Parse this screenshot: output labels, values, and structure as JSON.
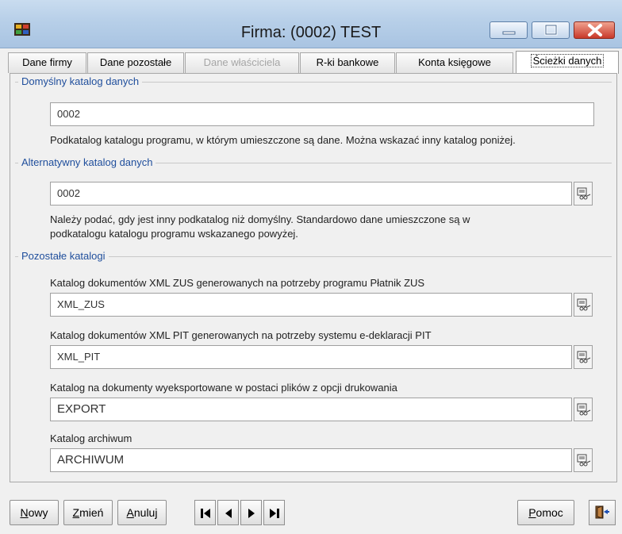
{
  "window": {
    "title": "Firma: (0002) TEST",
    "icons": {
      "app": "film-app-icon",
      "minimize": "minimize-icon",
      "maximize": "maximize-icon",
      "close": "close-icon"
    }
  },
  "tabs": [
    {
      "label": "Dane firmy",
      "state": "normal"
    },
    {
      "label": "Dane pozostałe",
      "state": "normal"
    },
    {
      "label": "Dane właściciela",
      "state": "disabled"
    },
    {
      "label": "R-ki bankowe",
      "state": "normal"
    },
    {
      "label": "Konta księgowe",
      "state": "normal"
    },
    {
      "label": "Ścieżki danych",
      "state": "active"
    }
  ],
  "default_dir": {
    "group_label": "Domyślny katalog danych",
    "value": "0002",
    "hint": "Podkatalog katalogu programu, w którym umieszczone są dane. Można wskazać inny katalog poniżej."
  },
  "alt_dir": {
    "group_label": "Alternatywny katalog danych",
    "value": "0002",
    "hint_line1": "Należy podać, gdy jest inny podkatalog niż domyślny. Standardowo dane umieszczone są w",
    "hint_line2": "podkatalogu katalogu programu wskazanego powyżej."
  },
  "other_dirs": {
    "group_label": "Pozostałe katalogi",
    "items": [
      {
        "label": "Katalog dokumentów XML ZUS generowanych na potrzeby programu Płatnik ZUS",
        "value": "XML_ZUS"
      },
      {
        "label": "Katalog dokumentów XML PIT generowanych na potrzeby systemu e-deklaracji PIT",
        "value": "XML_PIT"
      },
      {
        "label": "Katalog na dokumenty wyeksportowane w postaci plików z opcji drukowania",
        "value": "EXPORT"
      },
      {
        "label": "Katalog archiwum",
        "value": "ARCHIWUM"
      }
    ]
  },
  "buttons": {
    "new": {
      "hotkey": "N",
      "rest": "owy"
    },
    "edit": {
      "hotkey": "Z",
      "rest": "mień"
    },
    "cancel": {
      "hotkey": "A",
      "rest": "nuluj"
    },
    "help": {
      "hotkey": "P",
      "rest": "omoc"
    }
  },
  "nav_icons": [
    "first-record-icon",
    "previous-record-icon",
    "next-record-icon",
    "last-record-icon"
  ],
  "exit_icon": "exit-door-icon",
  "browse_icon": "browse-folder-icon",
  "colors": {
    "group_label": "#1f4e9c",
    "close_button": "#c8392a",
    "titlebar": "#b7cfe8"
  }
}
